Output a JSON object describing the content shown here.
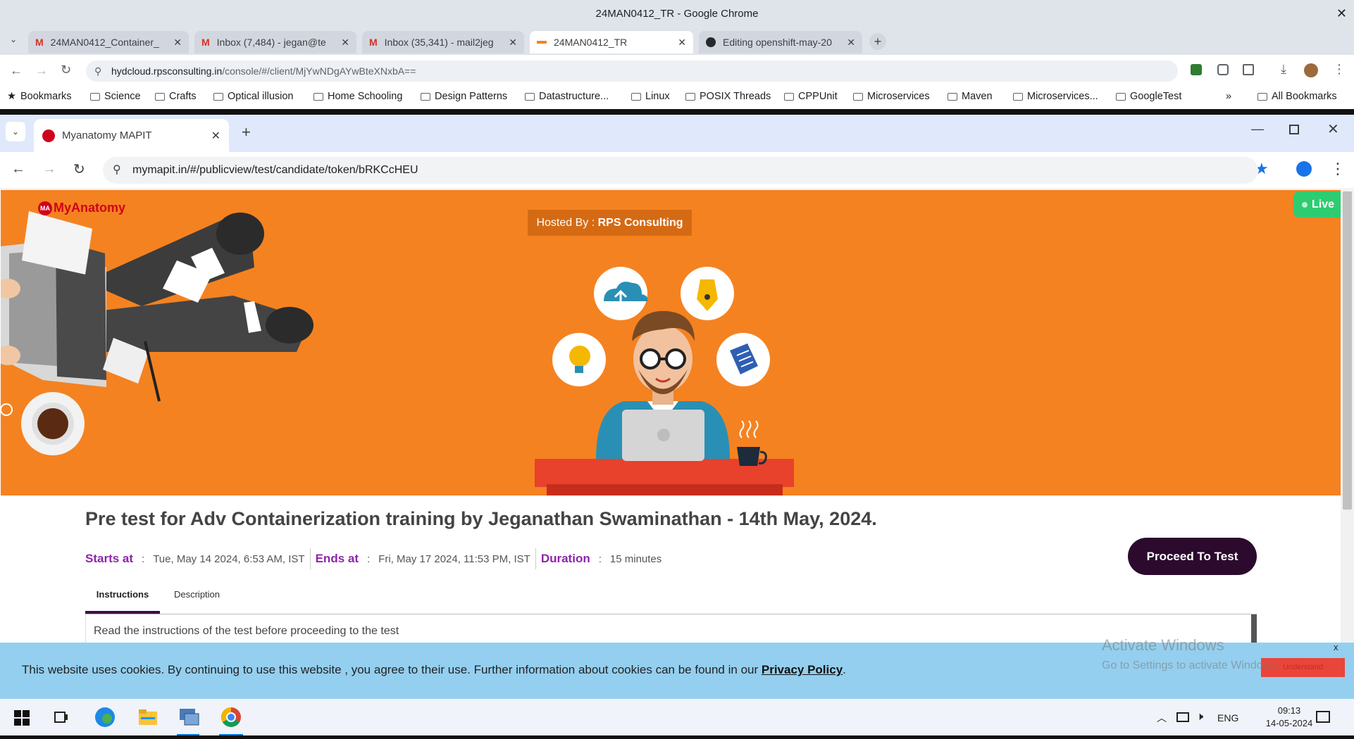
{
  "outer_window": {
    "title": "24MAN0412_TR - Google Chrome",
    "tabs": [
      {
        "label": "24MAN0412_Container_",
        "icon": "gmail-icon"
      },
      {
        "label": "Inbox (7,484) - jegan@te",
        "icon": "gmail-icon"
      },
      {
        "label": "Inbox (35,341) - mail2jeg",
        "icon": "gmail-icon"
      },
      {
        "label": "24MAN0412_TR",
        "icon": "rps-icon"
      },
      {
        "label": "Editing openshift-may-20",
        "icon": "github-icon"
      }
    ],
    "url_host": "hydcloud.rpsconsulting.in",
    "url_path": "/console/#/client/MjYwNDgAYwBteXNxbA==",
    "bookmarks": [
      "Bookmarks",
      "Science",
      "Crafts",
      "Optical illusion",
      "Home Schooling",
      "Design Patterns",
      "Datastructure...",
      "Linux",
      "POSIX Threads",
      "CPPUnit",
      "Microservices",
      "Maven",
      "Microservices...",
      "GoogleTest"
    ],
    "all_bookmarks": "All Bookmarks",
    "more": "»"
  },
  "inner_window": {
    "tab_title": "Myanatomy MAPIT",
    "url": "mymapit.in/#/publicview/test/candidate/token/bRKCcHEU"
  },
  "hero": {
    "logo_text": "MyAnatomy",
    "logo_badge": "MA",
    "hosted_prefix": "Hosted By : ",
    "hosted_by": "RPS Consulting",
    "live_label": "Live"
  },
  "test": {
    "title": "Pre test for Adv Containerization training by Jeganathan Swaminathan - 14th May, 2024.",
    "starts_label": "Starts at",
    "starts_value": "Tue, May 14 2024, 6:53 AM, IST",
    "ends_label": "Ends at",
    "ends_value": "Fri, May 17 2024, 11:53 PM, IST",
    "duration_label": "Duration",
    "duration_value": "15 minutes",
    "colon": ":",
    "proceed_label": "Proceed To Test",
    "tabs": [
      "Instructions",
      "Description"
    ],
    "instructions_text": "Read the instructions of the test before proceeding to the test"
  },
  "cookie": {
    "text": "This website uses cookies. By continuing to use this website , you agree to their use. Further information about cookies can be found in our ",
    "link": "Privacy Policy",
    "period": ".",
    "close": "x",
    "button": "Understand"
  },
  "watermark": {
    "line1": "Activate Windows",
    "line2": "Go to Settings to activate Windows."
  },
  "taskbar": {
    "lang": "ENG",
    "time": "09:13",
    "date": "14-05-2024"
  },
  "colors": {
    "hero": "#f58220",
    "accent_label": "#8e24aa",
    "proceed_bg": "#2b0a2e",
    "live": "#2ecc71",
    "cookie_bar": "#94cfef"
  }
}
